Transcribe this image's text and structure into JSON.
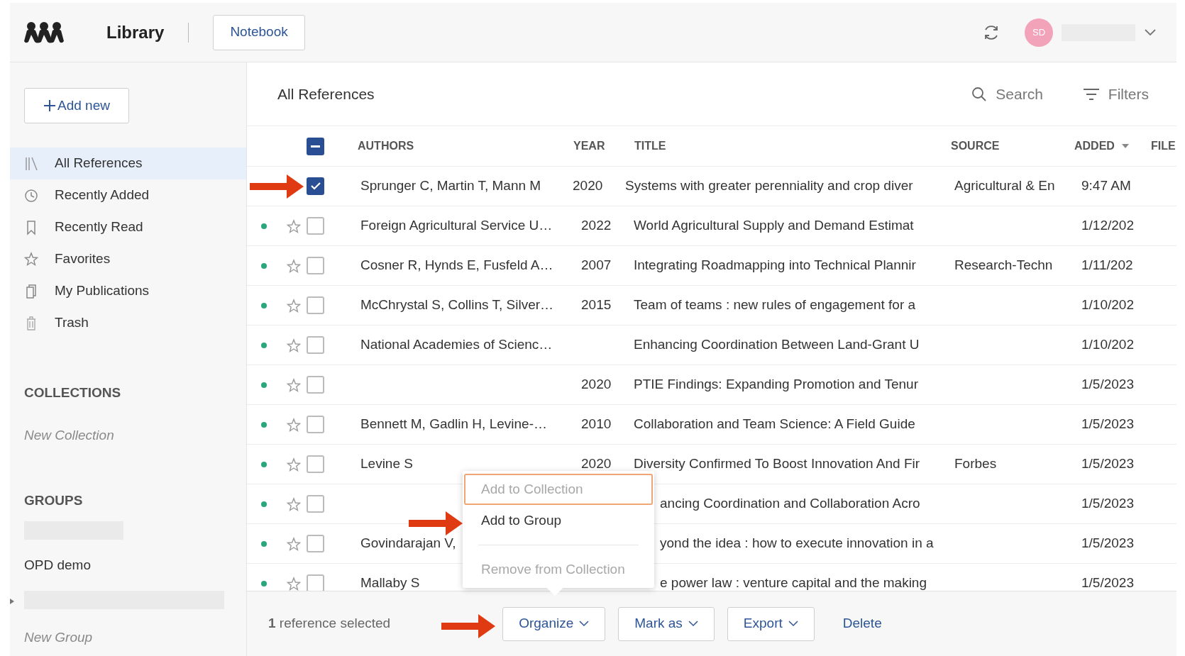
{
  "header": {
    "title": "Library",
    "notebook_button": "Notebook",
    "avatar_initials": "SD"
  },
  "sidebar": {
    "add_button": "Add new",
    "items": [
      {
        "label": "All References",
        "selected": true
      },
      {
        "label": "Recently Added",
        "selected": false
      },
      {
        "label": "Recently Read",
        "selected": false
      },
      {
        "label": "Favorites",
        "selected": false
      },
      {
        "label": "My Publications",
        "selected": false
      },
      {
        "label": "Trash",
        "selected": false
      }
    ],
    "collections": {
      "heading": "COLLECTIONS",
      "new_label": "New Collection"
    },
    "groups": {
      "heading": "GROUPS",
      "items": [
        {
          "kind": "redacted"
        },
        {
          "kind": "text",
          "label": "OPD demo"
        },
        {
          "kind": "redacted"
        }
      ],
      "new_label": "New Group"
    }
  },
  "main": {
    "title": "All References",
    "search_label": "Search",
    "filters_label": "Filters"
  },
  "table": {
    "select_all_mixed": true,
    "columns": [
      {
        "label": "AUTHORS",
        "sorted": false
      },
      {
        "label": "YEAR",
        "sorted": false
      },
      {
        "label": "TITLE",
        "sorted": false
      },
      {
        "label": "SOURCE",
        "sorted": false
      },
      {
        "label": "ADDED",
        "sorted": true
      },
      {
        "label": "FILE",
        "sorted": false
      }
    ],
    "rows": [
      {
        "kind": "full",
        "unread": false,
        "selected": true,
        "authors": "Sprunger C, Martin T, Mann M",
        "year": "2020",
        "title": "Systems with greater perenniality and crop diver",
        "source": "Agricultural & En",
        "added": "9:47 AM"
      },
      {
        "kind": "full",
        "unread": true,
        "selected": false,
        "authors": "Foreign Agricultural Service U…",
        "year": "2022",
        "title": "World Agricultural Supply and Demand Estimat",
        "source": "",
        "added": "1/12/202"
      },
      {
        "kind": "full",
        "unread": true,
        "selected": false,
        "authors": "Cosner R, Hynds E, Fusfeld A…",
        "year": "2007",
        "title": "Integrating Roadmapping into Technical Plannir",
        "source": "Research-Techn",
        "added": "1/11/202"
      },
      {
        "kind": "full",
        "unread": true,
        "selected": false,
        "authors": "McChrystal S, Collins T, Silver…",
        "year": "2015",
        "title": "Team of teams : new rules of engagement for a",
        "source": "",
        "added": "1/10/202"
      },
      {
        "kind": "full",
        "unread": true,
        "selected": false,
        "authors": "National Academies of Scienc…",
        "year": "",
        "title": "Enhancing Coordination Between Land-Grant U",
        "source": "",
        "added": "1/10/202"
      },
      {
        "kind": "full",
        "unread": true,
        "selected": false,
        "authors": "",
        "year": "2020",
        "title": "PTIE Findings: Expanding Promotion and Tenur",
        "source": "",
        "added": "1/5/2023"
      },
      {
        "kind": "full",
        "unread": true,
        "selected": false,
        "authors": "Bennett M, Gadlin H, Levine-…",
        "year": "2010",
        "title": "Collaboration and Team Science: A Field Guide",
        "source": "",
        "added": "1/5/2023"
      },
      {
        "kind": "full",
        "unread": true,
        "selected": false,
        "authors": "Levine S",
        "year": "2020",
        "title": "Diversity Confirmed To Boost Innovation And Fir",
        "source": "Forbes",
        "added": "1/5/2023"
      },
      {
        "kind": "clipped",
        "unread": true,
        "selected": false,
        "authors": "",
        "year": "",
        "title": "ancing Coordination and Collaboration Acro",
        "source": "",
        "added": "1/5/2023"
      },
      {
        "kind": "clipped",
        "unread": true,
        "selected": false,
        "authors": "Govindarajan V,",
        "year": "",
        "title": "yond the idea : how to execute innovation in a",
        "source": "",
        "added": "1/5/2023"
      },
      {
        "kind": "clipped",
        "unread": true,
        "selected": false,
        "authors": "Mallaby S",
        "year": "",
        "title": "e power law : venture capital and the making",
        "source": "",
        "added": "1/5/2023"
      }
    ]
  },
  "menu": {
    "items": [
      {
        "kind": "item",
        "label": "Add to Collection",
        "disabled": true,
        "focused": true
      },
      {
        "kind": "item",
        "label": "Add to Group",
        "disabled": false,
        "focused": false
      },
      {
        "kind": "divider"
      },
      {
        "kind": "item",
        "label": "Remove from Collection",
        "disabled": true,
        "focused": false
      }
    ]
  },
  "footer": {
    "selection_text": "**1** reference selected",
    "buttons": [
      {
        "kind": "dropdown",
        "label": "Organize"
      },
      {
        "kind": "dropdown",
        "label": "Mark as"
      },
      {
        "kind": "dropdown",
        "label": "Export"
      },
      {
        "kind": "link",
        "label": "Delete"
      }
    ]
  }
}
